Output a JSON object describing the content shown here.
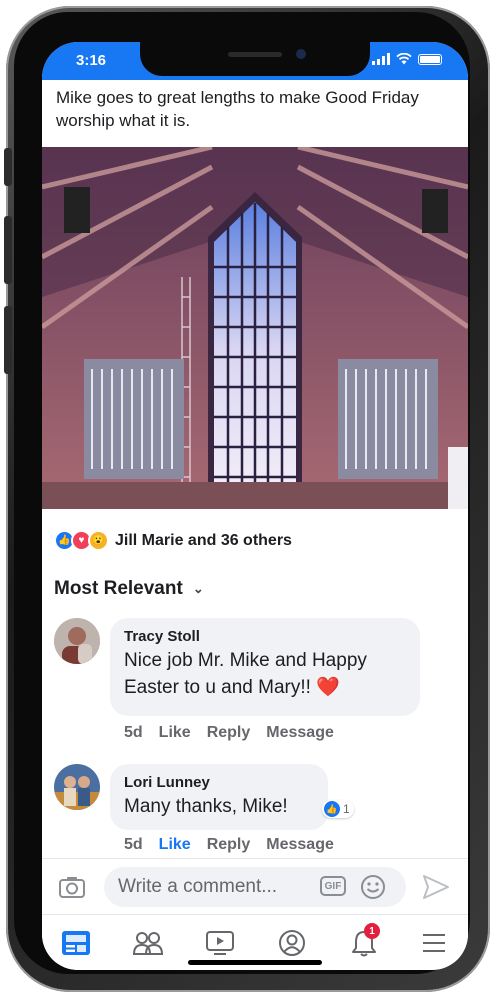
{
  "status_bar": {
    "time": "3:16"
  },
  "post": {
    "text": "Mike goes to great lengths to make Good Friday worship what it is.",
    "reactions_summary": "Jill Marie and 36 others"
  },
  "comments_sort": {
    "label": "Most Relevant"
  },
  "comments": [
    {
      "author": "Tracy Stoll",
      "text": "Nice job Mr. Mike and Happy Easter to u and Mary!! ❤️",
      "time": "5d",
      "like": "Like",
      "reply": "Reply",
      "message": "Message"
    },
    {
      "author": "Lori Lunney",
      "text": "Many thanks, Mike!",
      "reaction_count": "1",
      "time": "5d",
      "like": "Like",
      "reply": "Reply",
      "message": "Message"
    }
  ],
  "composer": {
    "placeholder": "Write a comment...",
    "gif_label": "GIF"
  },
  "nav": {
    "notifications_badge": "1"
  },
  "colors": {
    "brand": "#1877f2",
    "badge": "#e41e3f"
  }
}
